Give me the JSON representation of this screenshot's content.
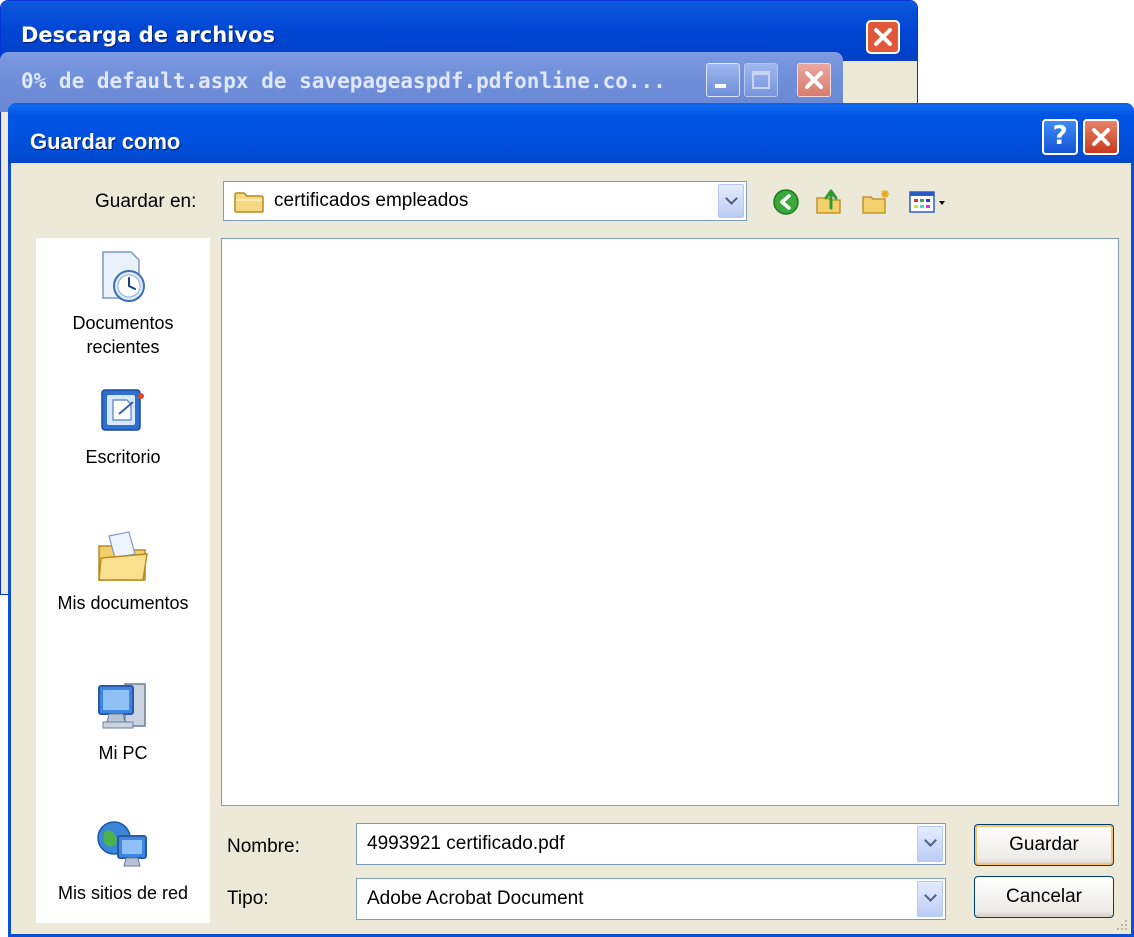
{
  "download_window": {
    "title": "Descarga de archivos"
  },
  "progress_window": {
    "title": "0% de default.aspx de savepageaspdf.pdfonline.co..."
  },
  "dialog": {
    "title": "Guardar como",
    "save_in_label": "Guardar en:",
    "save_in_value": "certificados empleados",
    "places": [
      {
        "label": "Documentos recientes",
        "icon": "recent-documents-icon"
      },
      {
        "label": "Escritorio",
        "icon": "desktop-icon"
      },
      {
        "label": "Mis documentos",
        "icon": "my-documents-icon"
      },
      {
        "label": "Mi PC",
        "icon": "my-computer-icon"
      },
      {
        "label": "Mis sitios de red",
        "icon": "network-places-icon"
      }
    ],
    "filename_label": "Nombre:",
    "filename_value": "4993921 certificado.pdf",
    "filetype_label": "Tipo:",
    "filetype_value": "Adobe Acrobat Document",
    "save_button": "Guardar",
    "cancel_button": "Cancelar"
  }
}
